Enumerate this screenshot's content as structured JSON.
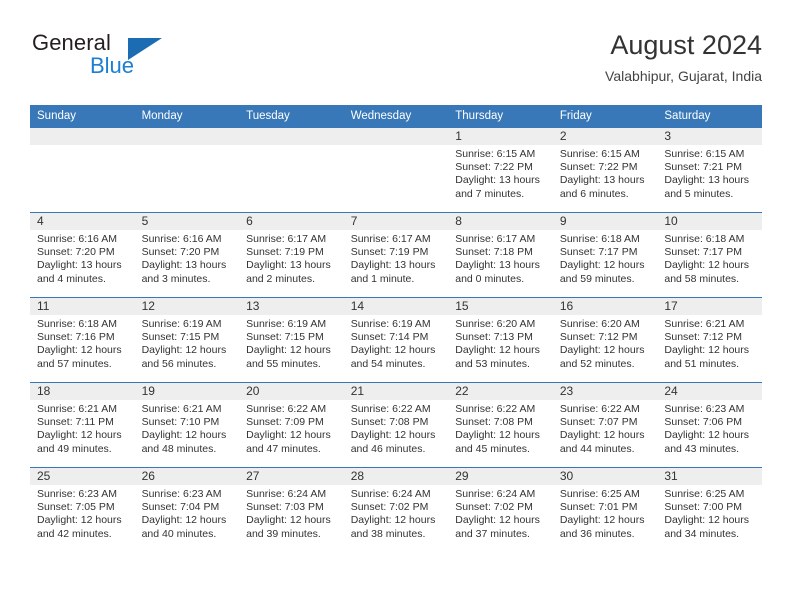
{
  "logo": {
    "word_one": "General",
    "word_two": "Blue",
    "triangle_color": "#1b6cb3",
    "blue_color": "#1b7fd4"
  },
  "header": {
    "title": "August 2024",
    "subtitle": "Valabhipur, Gujarat, India"
  },
  "theme": {
    "header_bg": "#3878b8",
    "header_text": "#ffffff",
    "daynum_bg": "#eeeeee",
    "row_border": "#3878b8",
    "body_text": "#333333"
  },
  "labels": {
    "sunrise_prefix": "Sunrise:",
    "sunset_prefix": "Sunset:",
    "daylight_prefix": "Daylight:"
  },
  "weekdays": [
    "Sunday",
    "Monday",
    "Tuesday",
    "Wednesday",
    "Thursday",
    "Friday",
    "Saturday"
  ],
  "weeks": [
    [
      {
        "day": "",
        "blank": true,
        "sunrise": "",
        "sunset": "",
        "daylight": ""
      },
      {
        "day": "",
        "blank": true,
        "sunrise": "",
        "sunset": "",
        "daylight": ""
      },
      {
        "day": "",
        "blank": true,
        "sunrise": "",
        "sunset": "",
        "daylight": ""
      },
      {
        "day": "",
        "blank": true,
        "sunrise": "",
        "sunset": "",
        "daylight": ""
      },
      {
        "day": "1",
        "blank": false,
        "sunrise": "Sunrise: 6:15 AM",
        "sunset": "Sunset: 7:22 PM",
        "daylight": "Daylight: 13 hours and 7 minutes."
      },
      {
        "day": "2",
        "blank": false,
        "sunrise": "Sunrise: 6:15 AM",
        "sunset": "Sunset: 7:22 PM",
        "daylight": "Daylight: 13 hours and 6 minutes."
      },
      {
        "day": "3",
        "blank": false,
        "sunrise": "Sunrise: 6:15 AM",
        "sunset": "Sunset: 7:21 PM",
        "daylight": "Daylight: 13 hours and 5 minutes."
      }
    ],
    [
      {
        "day": "4",
        "blank": false,
        "sunrise": "Sunrise: 6:16 AM",
        "sunset": "Sunset: 7:20 PM",
        "daylight": "Daylight: 13 hours and 4 minutes."
      },
      {
        "day": "5",
        "blank": false,
        "sunrise": "Sunrise: 6:16 AM",
        "sunset": "Sunset: 7:20 PM",
        "daylight": "Daylight: 13 hours and 3 minutes."
      },
      {
        "day": "6",
        "blank": false,
        "sunrise": "Sunrise: 6:17 AM",
        "sunset": "Sunset: 7:19 PM",
        "daylight": "Daylight: 13 hours and 2 minutes."
      },
      {
        "day": "7",
        "blank": false,
        "sunrise": "Sunrise: 6:17 AM",
        "sunset": "Sunset: 7:19 PM",
        "daylight": "Daylight: 13 hours and 1 minute."
      },
      {
        "day": "8",
        "blank": false,
        "sunrise": "Sunrise: 6:17 AM",
        "sunset": "Sunset: 7:18 PM",
        "daylight": "Daylight: 13 hours and 0 minutes."
      },
      {
        "day": "9",
        "blank": false,
        "sunrise": "Sunrise: 6:18 AM",
        "sunset": "Sunset: 7:17 PM",
        "daylight": "Daylight: 12 hours and 59 minutes."
      },
      {
        "day": "10",
        "blank": false,
        "sunrise": "Sunrise: 6:18 AM",
        "sunset": "Sunset: 7:17 PM",
        "daylight": "Daylight: 12 hours and 58 minutes."
      }
    ],
    [
      {
        "day": "11",
        "blank": false,
        "sunrise": "Sunrise: 6:18 AM",
        "sunset": "Sunset: 7:16 PM",
        "daylight": "Daylight: 12 hours and 57 minutes."
      },
      {
        "day": "12",
        "blank": false,
        "sunrise": "Sunrise: 6:19 AM",
        "sunset": "Sunset: 7:15 PM",
        "daylight": "Daylight: 12 hours and 56 minutes."
      },
      {
        "day": "13",
        "blank": false,
        "sunrise": "Sunrise: 6:19 AM",
        "sunset": "Sunset: 7:15 PM",
        "daylight": "Daylight: 12 hours and 55 minutes."
      },
      {
        "day": "14",
        "blank": false,
        "sunrise": "Sunrise: 6:19 AM",
        "sunset": "Sunset: 7:14 PM",
        "daylight": "Daylight: 12 hours and 54 minutes."
      },
      {
        "day": "15",
        "blank": false,
        "sunrise": "Sunrise: 6:20 AM",
        "sunset": "Sunset: 7:13 PM",
        "daylight": "Daylight: 12 hours and 53 minutes."
      },
      {
        "day": "16",
        "blank": false,
        "sunrise": "Sunrise: 6:20 AM",
        "sunset": "Sunset: 7:12 PM",
        "daylight": "Daylight: 12 hours and 52 minutes."
      },
      {
        "day": "17",
        "blank": false,
        "sunrise": "Sunrise: 6:21 AM",
        "sunset": "Sunset: 7:12 PM",
        "daylight": "Daylight: 12 hours and 51 minutes."
      }
    ],
    [
      {
        "day": "18",
        "blank": false,
        "sunrise": "Sunrise: 6:21 AM",
        "sunset": "Sunset: 7:11 PM",
        "daylight": "Daylight: 12 hours and 49 minutes."
      },
      {
        "day": "19",
        "blank": false,
        "sunrise": "Sunrise: 6:21 AM",
        "sunset": "Sunset: 7:10 PM",
        "daylight": "Daylight: 12 hours and 48 minutes."
      },
      {
        "day": "20",
        "blank": false,
        "sunrise": "Sunrise: 6:22 AM",
        "sunset": "Sunset: 7:09 PM",
        "daylight": "Daylight: 12 hours and 47 minutes."
      },
      {
        "day": "21",
        "blank": false,
        "sunrise": "Sunrise: 6:22 AM",
        "sunset": "Sunset: 7:08 PM",
        "daylight": "Daylight: 12 hours and 46 minutes."
      },
      {
        "day": "22",
        "blank": false,
        "sunrise": "Sunrise: 6:22 AM",
        "sunset": "Sunset: 7:08 PM",
        "daylight": "Daylight: 12 hours and 45 minutes."
      },
      {
        "day": "23",
        "blank": false,
        "sunrise": "Sunrise: 6:22 AM",
        "sunset": "Sunset: 7:07 PM",
        "daylight": "Daylight: 12 hours and 44 minutes."
      },
      {
        "day": "24",
        "blank": false,
        "sunrise": "Sunrise: 6:23 AM",
        "sunset": "Sunset: 7:06 PM",
        "daylight": "Daylight: 12 hours and 43 minutes."
      }
    ],
    [
      {
        "day": "25",
        "blank": false,
        "sunrise": "Sunrise: 6:23 AM",
        "sunset": "Sunset: 7:05 PM",
        "daylight": "Daylight: 12 hours and 42 minutes."
      },
      {
        "day": "26",
        "blank": false,
        "sunrise": "Sunrise: 6:23 AM",
        "sunset": "Sunset: 7:04 PM",
        "daylight": "Daylight: 12 hours and 40 minutes."
      },
      {
        "day": "27",
        "blank": false,
        "sunrise": "Sunrise: 6:24 AM",
        "sunset": "Sunset: 7:03 PM",
        "daylight": "Daylight: 12 hours and 39 minutes."
      },
      {
        "day": "28",
        "blank": false,
        "sunrise": "Sunrise: 6:24 AM",
        "sunset": "Sunset: 7:02 PM",
        "daylight": "Daylight: 12 hours and 38 minutes."
      },
      {
        "day": "29",
        "blank": false,
        "sunrise": "Sunrise: 6:24 AM",
        "sunset": "Sunset: 7:02 PM",
        "daylight": "Daylight: 12 hours and 37 minutes."
      },
      {
        "day": "30",
        "blank": false,
        "sunrise": "Sunrise: 6:25 AM",
        "sunset": "Sunset: 7:01 PM",
        "daylight": "Daylight: 12 hours and 36 minutes."
      },
      {
        "day": "31",
        "blank": false,
        "sunrise": "Sunrise: 6:25 AM",
        "sunset": "Sunset: 7:00 PM",
        "daylight": "Daylight: 12 hours and 34 minutes."
      }
    ]
  ]
}
